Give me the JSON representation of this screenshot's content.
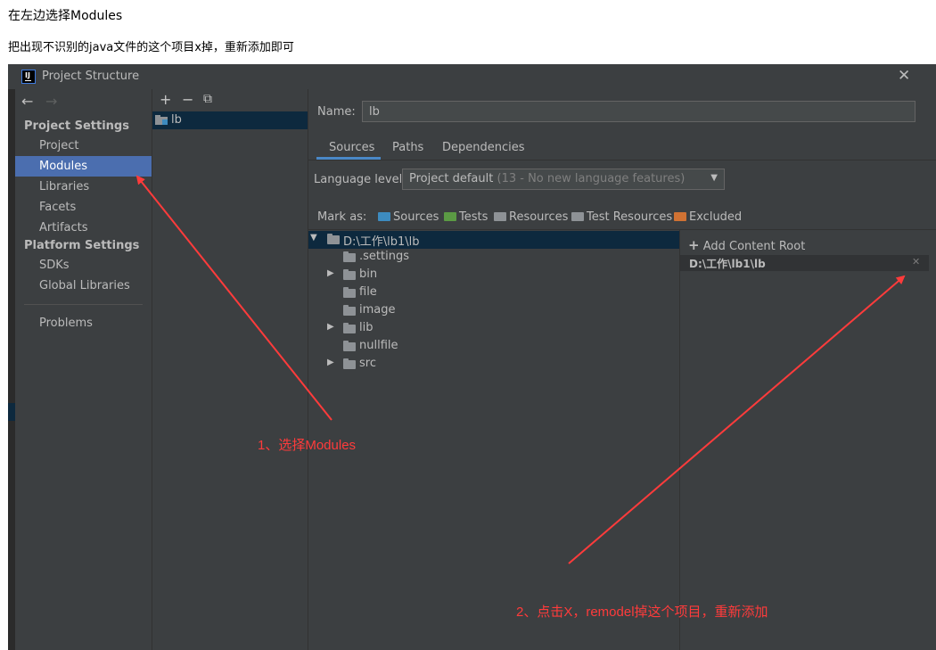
{
  "article": {
    "line1": "在左边选择Modules",
    "line2": "把出现不识别的java文件的这个项目x掉，重新添加即可"
  },
  "dialog": {
    "title": "Project Structure",
    "app_icon_text": "IJ",
    "close_glyph": "✕"
  },
  "sidebar": {
    "back": "←",
    "forward": "→",
    "project_settings_header": "Project Settings",
    "project_items": [
      "Project",
      "Modules",
      "Libraries",
      "Facets",
      "Artifacts"
    ],
    "platform_settings_header": "Platform Settings",
    "platform_items": [
      "SDKs",
      "Global Libraries"
    ],
    "problems": "Problems",
    "selected": "Modules"
  },
  "modules": {
    "add": "+",
    "remove": "−",
    "copy": "⧉",
    "items": [
      "lb"
    ]
  },
  "module_detail": {
    "name_label": "Name:",
    "name_value": "lb",
    "tabs": [
      "Sources",
      "Paths",
      "Dependencies"
    ],
    "active_tab": "Sources",
    "language_level_label": "Language level:",
    "language_level_value": "Project default",
    "language_level_hint": "(13 - No new language features)",
    "mark_as_label": "Mark as:",
    "mark_as": [
      {
        "label": "Sources",
        "color": "#3d8bbf"
      },
      {
        "label": "Tests",
        "color": "#5b9a44"
      },
      {
        "label": "Resources",
        "color": "#8e9296"
      },
      {
        "label": "Test Resources",
        "color": "#8e9296"
      },
      {
        "label": "Excluded",
        "color": "#d07233"
      }
    ]
  },
  "file_tree": {
    "root": "D:\\工作\\lb1\\lb",
    "children": [
      {
        "name": ".settings",
        "expandable": false
      },
      {
        "name": "bin",
        "expandable": true
      },
      {
        "name": "file",
        "expandable": false
      },
      {
        "name": "image",
        "expandable": false
      },
      {
        "name": "lib",
        "expandable": true
      },
      {
        "name": "nullfile",
        "expandable": false
      },
      {
        "name": "src",
        "expandable": true
      }
    ]
  },
  "content_roots": {
    "add_label": "Add Content Root",
    "root_path": "D:\\工作\\lb1\\lb",
    "remove_glyph": "✕"
  },
  "annotations": {
    "step1": "1、选择Modules",
    "step2": "2、点击X，remodel掉这个项目，重新添加",
    "color": "#ff3b3b"
  }
}
